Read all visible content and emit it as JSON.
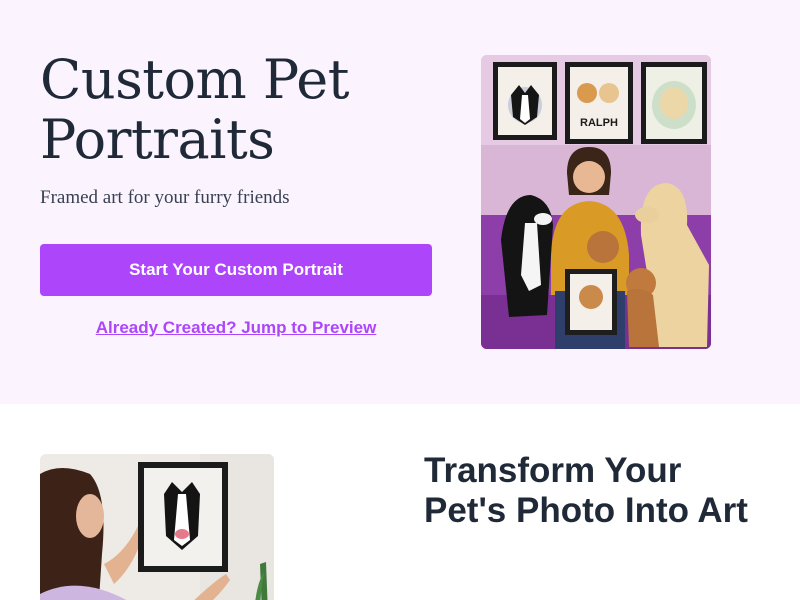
{
  "hero": {
    "title": "Custom Pet Portraits",
    "subtitle": "Framed art for your furry friends",
    "cta_label": "Start Your Custom Portrait",
    "link_label": "Already Created? Jump to Preview",
    "image_frame_label": "RALPH"
  },
  "feature": {
    "title": "Transform Your Pet's Photo Into Art"
  },
  "colors": {
    "accent": "#ad46fb",
    "hero_background": "#fbf3fe",
    "text_dark": "#1f2937"
  }
}
